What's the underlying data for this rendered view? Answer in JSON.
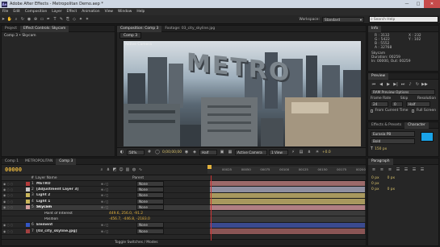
{
  "titlebar": {
    "title": "Adobe After Effects - Metropolitan Demo.aep *",
    "min": "—",
    "max": "□",
    "close": "✕"
  },
  "menu": [
    "File",
    "Edit",
    "Composition",
    "Layer",
    "Effect",
    "Animation",
    "View",
    "Window",
    "Help"
  ],
  "toolbar": {
    "workspace_label": "Workspace:",
    "workspace_value": "Standard",
    "search_placeholder": "Search Help"
  },
  "left_panel": {
    "tabs": [
      "Project",
      "Effect Controls: Skycam"
    ],
    "breadcrumb": "Comp 3 • Skycam"
  },
  "viewer": {
    "tabs": [
      "Composition: Comp 3",
      "Footage: 03_city_skyline.jpg"
    ],
    "subtab": "Comp 3",
    "camera_label": "Active Camera",
    "sign_text": "METRO",
    "bar": {
      "zoom": "50%",
      "timecode": "0;00;00;00",
      "resolution": "Half",
      "camera": "Active Camera",
      "views": "1 View",
      "exposure": "+0.0"
    }
  },
  "info": {
    "tab": "Info",
    "rgba": [
      "R : 3132",
      "G : 5422",
      "B : 5552",
      "A : 32768"
    ],
    "xy": [
      "X : 232",
      "Y : 102"
    ],
    "layer_name": "Skycam",
    "lines": [
      "Duration: 00259",
      "In: 00000, Out: 00259"
    ]
  },
  "preview": {
    "tab": "Preview",
    "ram_options": "RAM Preview Options",
    "labels": [
      "Frame Rate",
      "Skip",
      "Resolution"
    ],
    "values": [
      "24",
      "0",
      "Half"
    ],
    "checks": [
      "From Current Time",
      "Full Screen"
    ]
  },
  "character": {
    "tabs": [
      "Effects & Presets",
      "Character"
    ],
    "font": "Eurasia PB",
    "style": "Bold",
    "size": "150 px",
    "color": "#1aa3e8"
  },
  "paragraph": {
    "tab": "Paragraph",
    "values": [
      "0 px",
      "0 px",
      "0 px",
      "0 px",
      "0 px"
    ]
  },
  "timeline": {
    "tabs": [
      "Comp 1",
      "METROPOLITAN",
      "Comp 3"
    ],
    "timecode": "00000",
    "headers": [
      "#",
      "Layer Name",
      "Parent"
    ],
    "ruler": [
      "00025",
      "00050",
      "00075",
      "00100",
      "00125",
      "00150",
      "00175",
      "00200",
      "00225",
      "00250"
    ],
    "layers": [
      {
        "num": "1",
        "name": "METRO",
        "parent": "None",
        "color": "#b23a3a",
        "bar": "#9c6a6a",
        "selected": false,
        "prop": false
      },
      {
        "num": "2",
        "name": "[Adjustment Layer 3]",
        "parent": "None",
        "color": "#c8c8c8",
        "bar": "#8f8fa0",
        "selected": false,
        "prop": false
      },
      {
        "num": "3",
        "name": "Light 2",
        "parent": "None",
        "color": "#c9b55a",
        "bar": "#a8985e",
        "selected": false,
        "prop": false
      },
      {
        "num": "4",
        "name": "Light 1",
        "parent": "None",
        "color": "#c9b55a",
        "bar": "#a8985e",
        "selected": false,
        "prop": false
      },
      {
        "num": "5",
        "name": "Skycam",
        "parent": "None",
        "color": "#d7a0a0",
        "bar": "#b07f84",
        "selected": true,
        "prop": false
      },
      {
        "num": "",
        "name": "Point of Interest",
        "parent": "",
        "value": "449.6, 256.0, -91.2",
        "color": "",
        "bar": "#3a3a3a",
        "selected": false,
        "prop": true
      },
      {
        "num": "",
        "name": "Position",
        "parent": "",
        "value": "-456.7, -446.8, -2183.0",
        "color": "",
        "bar": "#3a3a3a",
        "selected": false,
        "prop": true
      },
      {
        "num": "6",
        "name": "Element",
        "parent": "None",
        "color": "#3456c4",
        "bar": "#3b4a8f",
        "selected": false,
        "prop": false
      },
      {
        "num": "7",
        "name": "[03_city_skyline.jpg]",
        "parent": "None",
        "color": "#a24040",
        "bar": "#8a5555",
        "selected": false,
        "prop": false
      }
    ],
    "footer": "Toggle Switches / Modes"
  }
}
